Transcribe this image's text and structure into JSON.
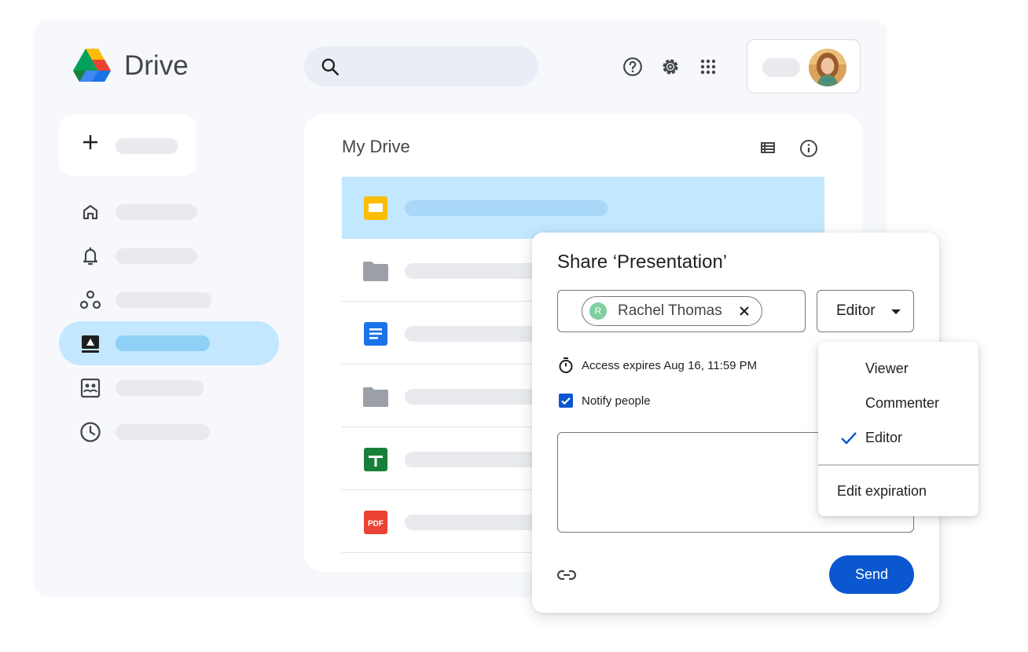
{
  "app": {
    "name": "Drive"
  },
  "main": {
    "title": "My Drive"
  },
  "files": [
    {
      "icon": "slides-icon",
      "selected": true
    },
    {
      "icon": "folder-icon",
      "selected": false
    },
    {
      "icon": "docs-icon",
      "selected": false
    },
    {
      "icon": "folder-icon",
      "selected": false
    },
    {
      "icon": "sheets-icon",
      "selected": false
    },
    {
      "icon": "pdf-icon",
      "selected": false,
      "badge": "PDF"
    }
  ],
  "share_dialog": {
    "title": "Share ‘Presentation’",
    "recipient": {
      "name": "Rachel Thomas",
      "initial": "R"
    },
    "role": "Editor",
    "expiry": "Access expires Aug 16, 11:59 PM",
    "notify_label": "Notify people",
    "notify_checked": true,
    "message_value": "",
    "send_label": "Send"
  },
  "role_menu": {
    "items": [
      {
        "label": "Viewer",
        "checked": false
      },
      {
        "label": "Commenter",
        "checked": false
      },
      {
        "label": "Editor",
        "checked": true
      }
    ],
    "footer": "Edit expiration"
  },
  "colors": {
    "accent": "#0b57d0",
    "selection": "#c2e7ff",
    "background": "#f6f8fc"
  }
}
